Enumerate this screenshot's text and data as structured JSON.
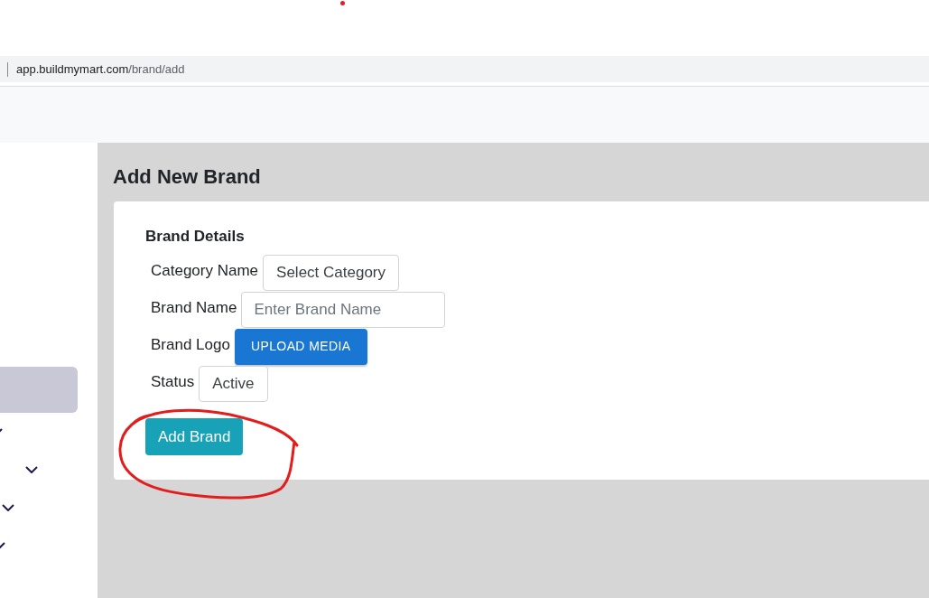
{
  "browser": {
    "url_host": "app.buildmymart.com",
    "url_path": "/brand/add"
  },
  "sidebar": {
    "items": [
      {
        "selected": true
      },
      {
        "selected": false
      },
      {
        "selected": false
      },
      {
        "selected": false
      },
      {
        "selected": false
      }
    ]
  },
  "page": {
    "title": "Add New Brand"
  },
  "form": {
    "section_title": "Brand Details",
    "fields": [
      {
        "kind": "select",
        "label": "Category Name",
        "value": "Select Category"
      },
      {
        "kind": "text",
        "label": "Brand Name",
        "placeholder": "Enter Brand Name"
      },
      {
        "kind": "upload",
        "label": "Brand Logo",
        "button": "UPLOAD MEDIA"
      },
      {
        "kind": "select",
        "label": "Status",
        "value": "Active"
      }
    ],
    "submit": "Add Brand"
  }
}
